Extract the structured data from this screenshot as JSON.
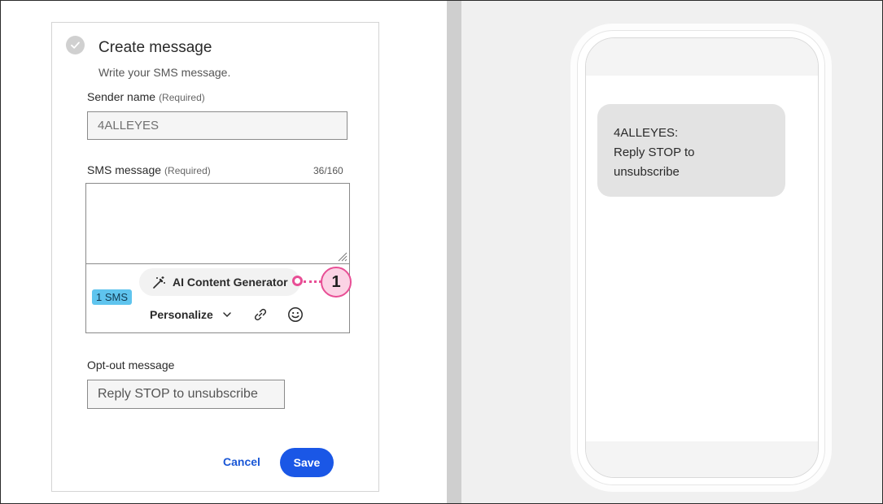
{
  "form": {
    "title": "Create message",
    "subtitle": "Write your SMS message.",
    "sender": {
      "label": "Sender name",
      "required": "(Required)",
      "value": "4ALLEYES"
    },
    "sms": {
      "label": "SMS message",
      "required": "(Required)",
      "counter": "36/160",
      "value": "",
      "badge": "1 SMS",
      "ai_button": "AI Content Generator",
      "personalize": "Personalize"
    },
    "optout": {
      "label": "Opt-out message",
      "value": "Reply STOP to unsubscribe"
    },
    "actions": {
      "cancel": "Cancel",
      "save": "Save"
    }
  },
  "callout": {
    "number": "1"
  },
  "preview": {
    "message": "4ALLEYES:\nReply STOP to\nunsubscribe"
  },
  "colors": {
    "accent_blue": "#1a57e6",
    "link_blue": "#1a57d6",
    "badge_blue": "#5fc4ee",
    "callout_pink": "#e84e95",
    "callout_fill": "#fbd3e5",
    "bubble_gray": "#e3e3e3"
  },
  "icons": [
    "check-circle-icon",
    "magic-wand-icon",
    "chevron-down-icon",
    "link-icon",
    "emoji-icon",
    "resize-handle-icon"
  ]
}
